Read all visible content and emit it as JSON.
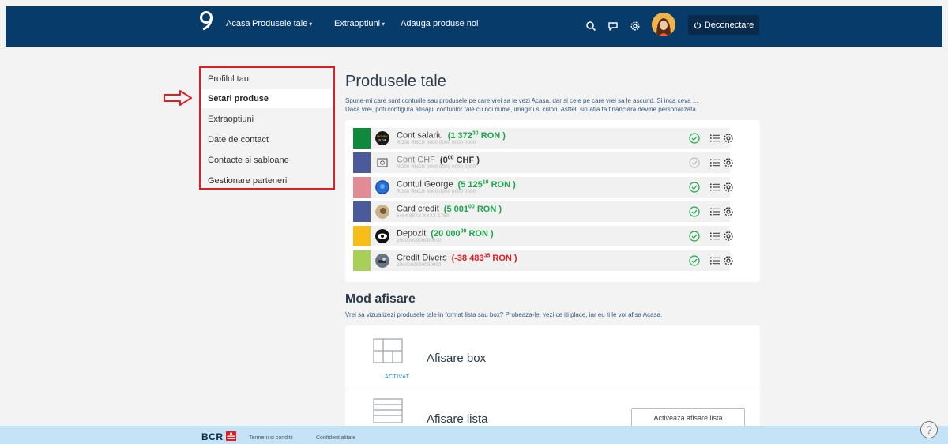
{
  "nav": {
    "items": [
      {
        "label": "Acasa"
      },
      {
        "label": "Produsele tale",
        "caret": "▾"
      },
      {
        "label": "Extraoptiuni",
        "caret": "▾"
      },
      {
        "label": "Adauga produse noi"
      }
    ],
    "logout_label": "Deconectare",
    "icons": [
      "search-icon",
      "chat-icon",
      "settings-icon"
    ]
  },
  "sidebar": {
    "items": [
      {
        "label": "Profilul tau",
        "active": false
      },
      {
        "label": "Setari produse",
        "active": true
      },
      {
        "label": "Extraoptiuni",
        "active": false
      },
      {
        "label": "Date de contact",
        "active": false
      },
      {
        "label": "Contacte si sabloane",
        "active": false
      },
      {
        "label": "Gestionare parteneri",
        "active": false
      }
    ]
  },
  "main": {
    "title": "Produsele tale",
    "description_line1": "Spune-mi care sunt conturile sau produsele pe care vrei sa le vezi Acasa, dar si cele pe care vrei sa le ascund. Si inca ceva ...",
    "description_line2": "Daca vrei, poti configura afisajul conturilor tale cu noi nume, imagini si culori. Astfel, situatia ta financiara devine personalizata.",
    "accounts": [
      {
        "name": "Cont salariu",
        "int": "1 372",
        "dec": "30",
        "currency": "RON",
        "iban": "RO00 RNCB 0000 0000 0000 0000",
        "color": "#0f8a3c",
        "visible": true,
        "amount_style": "pos"
      },
      {
        "name": "Cont CHF",
        "int": "0",
        "dec": "00",
        "currency": "CHF",
        "iban": "RO00 RNCB 0000 0000 0000 0000",
        "color": "#4a5a9a",
        "visible": false,
        "amount_style": "neutral"
      },
      {
        "name": "Contul George",
        "int": "5 125",
        "dec": "10",
        "currency": "RON",
        "iban": "RO00 RNCB 0000 0000 0000 0000",
        "color": "#e28a96",
        "visible": true,
        "amount_style": "pos"
      },
      {
        "name": "Card credit",
        "int": "5 001",
        "dec": "00",
        "currency": "RON",
        "iban": "5464 88XX XXXX 1750",
        "color": "#4a5a9a",
        "visible": true,
        "amount_style": "pos"
      },
      {
        "name": "Depozit",
        "int": "20 000",
        "dec": "00",
        "currency": "RON",
        "iban": "2000000000000000",
        "color": "#f7bd1a",
        "visible": true,
        "amount_style": "pos"
      },
      {
        "name": "Credit Divers",
        "int": "-38 483",
        "dec": "35",
        "currency": "RON",
        "iban": "2000000000000000",
        "color": "#a8cf58",
        "visible": true,
        "amount_style": "neg"
      }
    ]
  },
  "display": {
    "title": "Mod afisare",
    "description": "Vrei sa vizualizezi produsele tale in format lista sau box? Probeaza-le, vezi ce iti place, iar eu ti le voi afisa Acasa.",
    "box_label": "Afisare box",
    "box_status": "ACTIVAT",
    "list_label": "Afisare lista",
    "list_button": "Activeaza afisare lista"
  },
  "footer": {
    "brand": "BCR",
    "links": [
      "Termeni si conditii",
      "Confidentialitate"
    ],
    "help": "?"
  }
}
